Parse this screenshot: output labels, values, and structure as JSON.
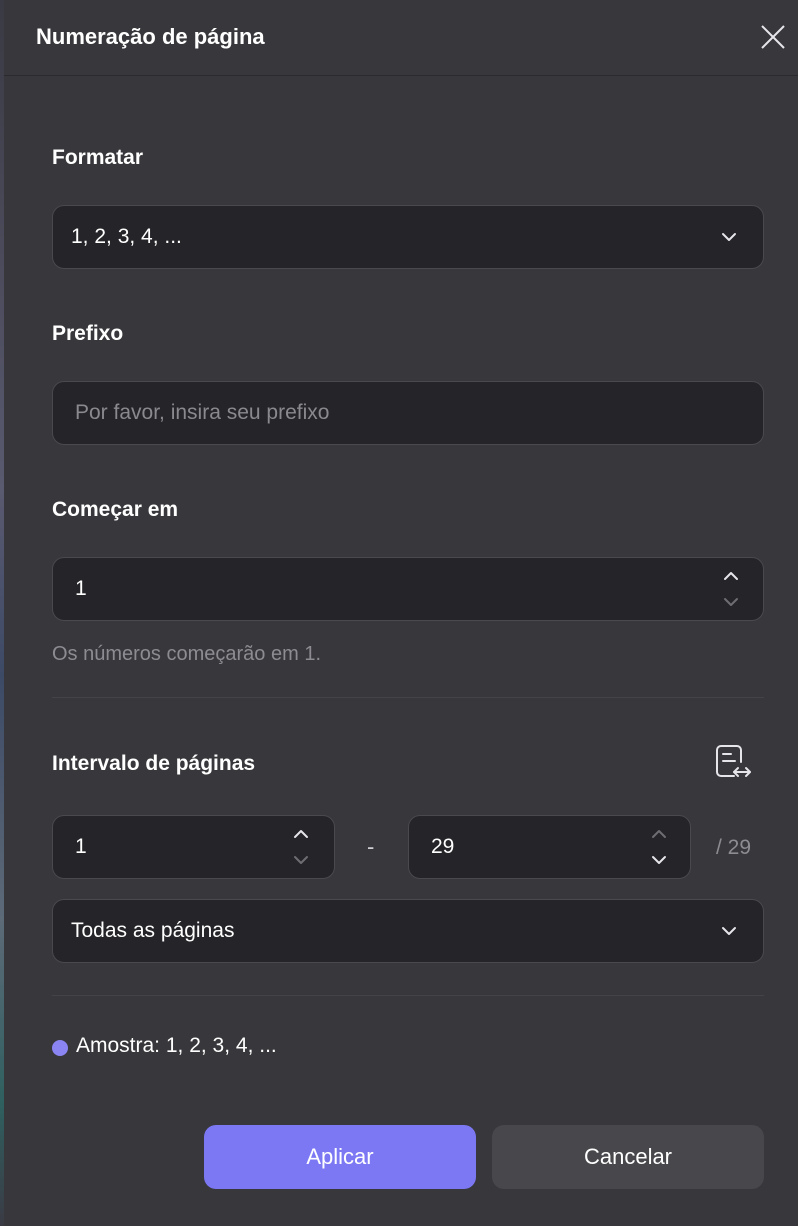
{
  "dialog": {
    "title": "Numeração de página"
  },
  "format": {
    "label": "Formatar",
    "selected": "1, 2, 3, 4, ..."
  },
  "prefix": {
    "label": "Prefixo",
    "value": "",
    "placeholder": "Por favor, insira seu prefixo"
  },
  "start": {
    "label": "Começar em",
    "value": "1",
    "hint": "Os números começarão em 1."
  },
  "range": {
    "label": "Intervalo de páginas",
    "from": "1",
    "separator": "-",
    "to": "29",
    "total": "/ 29",
    "pages_selected": "Todas as páginas"
  },
  "sample": {
    "text": "Amostra: 1, 2, 3, 4, ..."
  },
  "buttons": {
    "apply": "Aplicar",
    "cancel": "Cancelar"
  },
  "icons": {
    "close": "close-icon",
    "chevron": "chevron-down-icon",
    "stepper": "stepper-icon",
    "page_range": "page-range-icon"
  },
  "colors": {
    "accent": "#7c78f4",
    "dialog_bg": "#38373b",
    "field_bg": "#252428",
    "sample_dot": "#8a85f2"
  }
}
